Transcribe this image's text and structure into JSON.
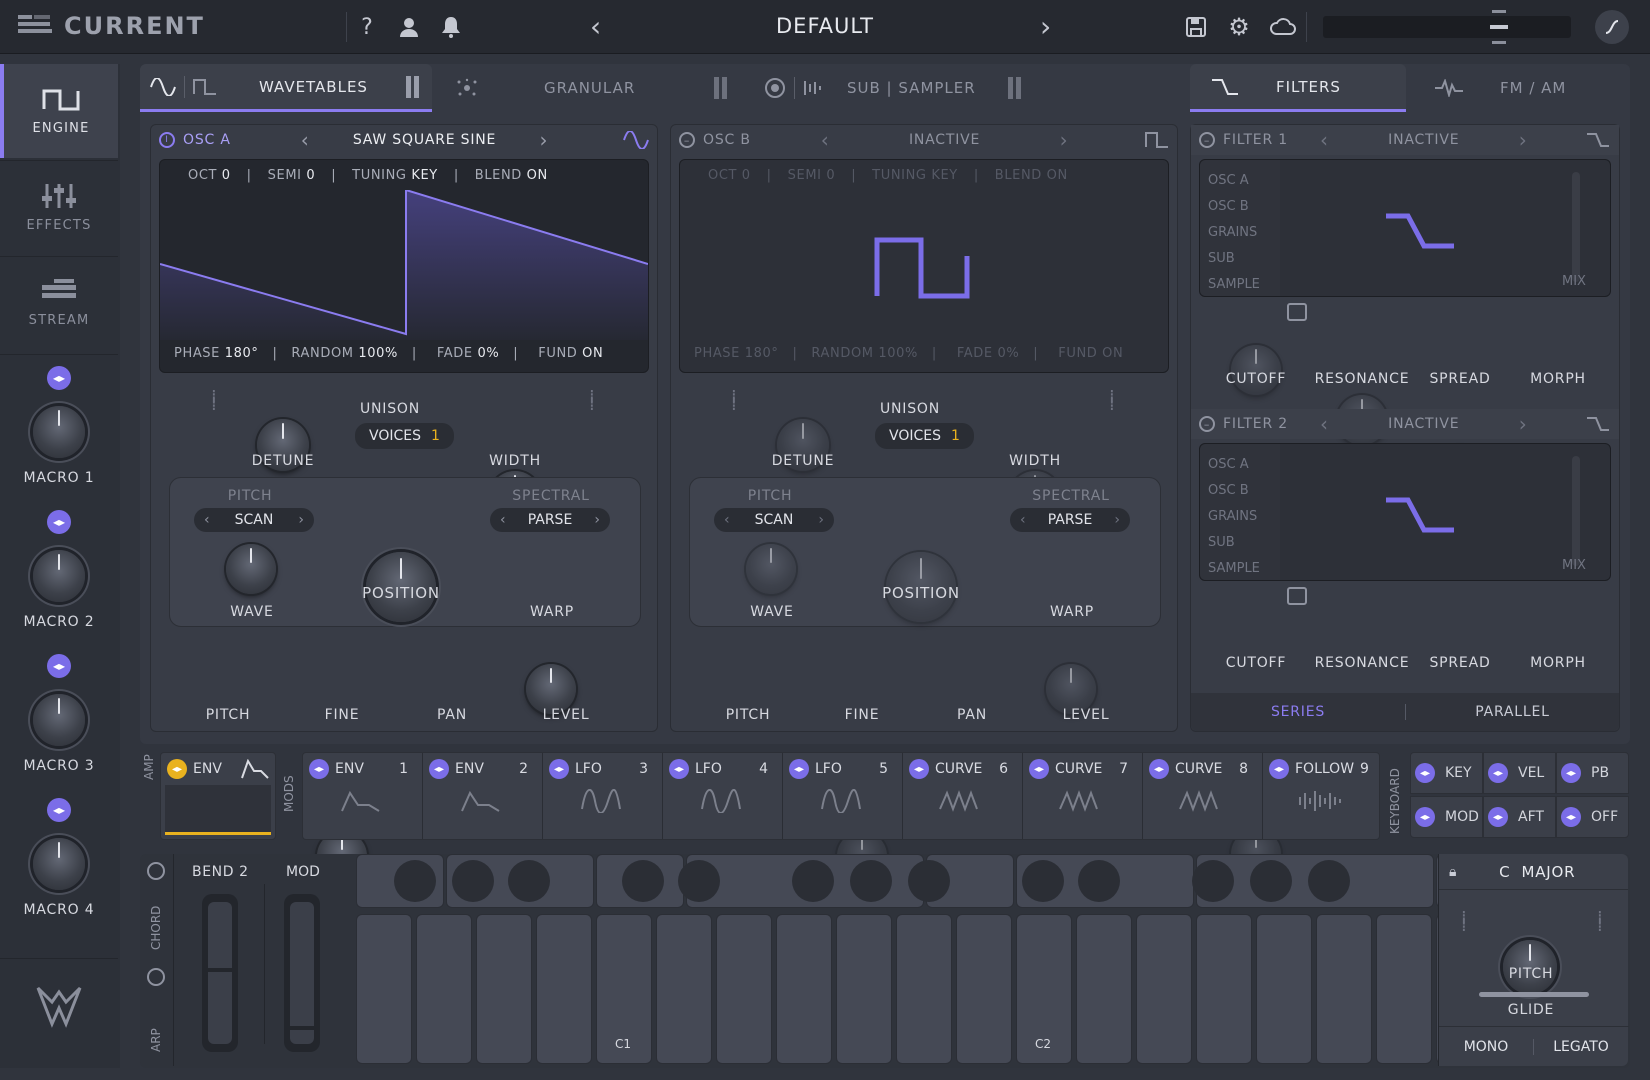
{
  "topbar": {
    "logo_text": "CURRENT",
    "preset_name": "DEFAULT",
    "help_icon": "question-icon",
    "user_icon": "user-icon",
    "bell_icon": "bell-icon",
    "prev": "‹",
    "next": "›"
  },
  "nav": {
    "engine": "ENGINE",
    "effects": "EFFECTS",
    "stream": "STREAM"
  },
  "macros": [
    "MACRO 1",
    "MACRO 2",
    "MACRO 3",
    "MACRO 4"
  ],
  "tabs": {
    "wavetables": "WAVETABLES",
    "granular": "GRANULAR",
    "sub_sampler": "SUB | SAMPLER",
    "filters": "FILTERS",
    "fm_am": "FM / AM"
  },
  "osc_a": {
    "title": "OSC A",
    "wavetable": "SAW SQUARE SINE",
    "oct_label": "OCT",
    "oct": "0",
    "semi_label": "SEMI",
    "semi": "0",
    "tuning_label": "TUNING",
    "tuning": "KEY",
    "blend_label": "BLEND",
    "blend": "ON",
    "phase_label": "PHASE",
    "phase": "180°",
    "random_label": "RANDOM",
    "random": "100%",
    "fade_label": "FADE",
    "fade": "0%",
    "fund_label": "FUND",
    "fund": "ON",
    "detune": "DETUNE",
    "unison": "UNISON",
    "voices_label": "VOICES",
    "voices": "1",
    "width": "WIDTH",
    "pitch_section": "PITCH",
    "pitch_mode": "SCAN",
    "spectral_section": "SPECTRAL",
    "spectral_mode": "PARSE",
    "wave": "WAVE",
    "position": "POSITION",
    "warp": "WARP",
    "k_pitch": "PITCH",
    "k_fine": "FINE",
    "k_pan": "PAN",
    "k_level": "LEVEL"
  },
  "osc_b": {
    "title": "OSC B",
    "wavetable": "INACTIVE",
    "oct_label": "OCT",
    "oct": "0",
    "semi_label": "SEMI",
    "semi": "0",
    "tuning_label": "TUNING",
    "tuning": "KEY",
    "blend_label": "BLEND",
    "blend": "ON",
    "phase_label": "PHASE",
    "phase": "180°",
    "random_label": "RANDOM",
    "random": "100%",
    "fade_label": "FADE",
    "fade": "0%",
    "fund_label": "FUND",
    "fund": "ON",
    "detune": "DETUNE",
    "unison": "UNISON",
    "voices_label": "VOICES",
    "voices": "1",
    "width": "WIDTH",
    "pitch_section": "PITCH",
    "pitch_mode": "SCAN",
    "spectral_section": "SPECTRAL",
    "spectral_mode": "PARSE",
    "wave": "WAVE",
    "position": "POSITION",
    "warp": "WARP",
    "k_pitch": "PITCH",
    "k_fine": "FINE",
    "k_pan": "PAN",
    "k_level": "LEVEL"
  },
  "filter1": {
    "title": "FILTER 1",
    "state": "INACTIVE",
    "sources": [
      "OSC A",
      "OSC B",
      "GRAINS",
      "SUB",
      "SAMPLE"
    ],
    "mix": "MIX",
    "cutoff": "CUTOFF",
    "resonance": "RESONANCE",
    "spread": "SPREAD",
    "morph": "MORPH"
  },
  "filter2": {
    "title": "FILTER 2",
    "state": "INACTIVE",
    "sources": [
      "OSC A",
      "OSC B",
      "GRAINS",
      "SUB",
      "SAMPLE"
    ],
    "mix": "MIX",
    "cutoff": "CUTOFF",
    "resonance": "RESONANCE",
    "spread": "SPREAD",
    "morph": "MORPH"
  },
  "routing": {
    "series": "SERIES",
    "parallel": "PARALLEL"
  },
  "mods": {
    "amp_label": "AMP",
    "mods_label": "MODS",
    "amp_env": "ENV",
    "slots": [
      {
        "name": "ENV",
        "num": "1"
      },
      {
        "name": "ENV",
        "num": "2"
      },
      {
        "name": "LFO",
        "num": "3"
      },
      {
        "name": "LFO",
        "num": "4"
      },
      {
        "name": "LFO",
        "num": "5"
      },
      {
        "name": "CURVE",
        "num": "6"
      },
      {
        "name": "CURVE",
        "num": "7"
      },
      {
        "name": "CURVE",
        "num": "8"
      },
      {
        "name": "FOLLOW",
        "num": "9"
      }
    ],
    "keyboard_label": "KEYBOARD",
    "kb": [
      "KEY",
      "VEL",
      "PB",
      "MOD",
      "AFT",
      "OFF"
    ]
  },
  "performance": {
    "chord": "CHORD",
    "arp": "ARP",
    "bend_label": "BEND",
    "bend": "2",
    "mod": "MOD",
    "c1": "C1",
    "c2": "C2",
    "scale_root": "C",
    "scale_mode": "MAJOR",
    "pitch": "PITCH",
    "glide": "GLIDE",
    "mono": "MONO",
    "legato": "LEGATO"
  },
  "colors": {
    "accent": "#8b7cf0",
    "amp_accent": "#e9b21f",
    "bg": "#30343d"
  }
}
